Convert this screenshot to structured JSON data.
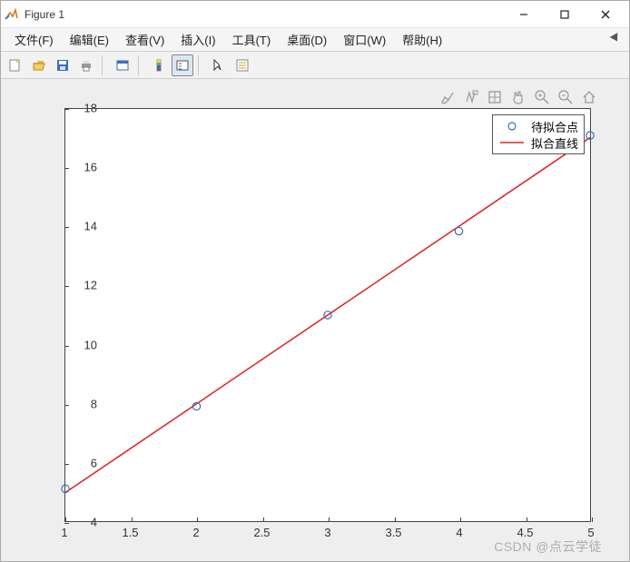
{
  "window": {
    "title": "Figure 1"
  },
  "menu": {
    "file": "文件(F)",
    "edit": "编辑(E)",
    "view": "查看(V)",
    "insert": "插入(I)",
    "tools": "工具(T)",
    "desktop": "桌面(D)",
    "window": "窗口(W)",
    "help": "帮助(H)"
  },
  "legend": {
    "points": "待拟合点",
    "line": "拟合直线"
  },
  "watermark": "CSDN @点云学徒",
  "colors": {
    "marker": "#3b6fb3",
    "line": "#e02020",
    "axis": "#444444"
  },
  "chart_data": {
    "type": "scatter+line",
    "xlabel": "",
    "ylabel": "",
    "title": "",
    "xlim": [
      1,
      5
    ],
    "ylim": [
      4,
      18
    ],
    "xticks": [
      1,
      1.5,
      2,
      2.5,
      3,
      3.5,
      4,
      4.5,
      5
    ],
    "yticks": [
      4,
      6,
      8,
      10,
      12,
      14,
      16,
      18
    ],
    "series": [
      {
        "name": "待拟合点",
        "kind": "scatter",
        "x": [
          1,
          2,
          3,
          4,
          5
        ],
        "y": [
          5.1,
          7.9,
          11.0,
          13.85,
          17.1
        ]
      },
      {
        "name": "拟合直线",
        "kind": "line",
        "x": [
          1,
          5
        ],
        "y": [
          4.97,
          17.03
        ]
      }
    ]
  }
}
